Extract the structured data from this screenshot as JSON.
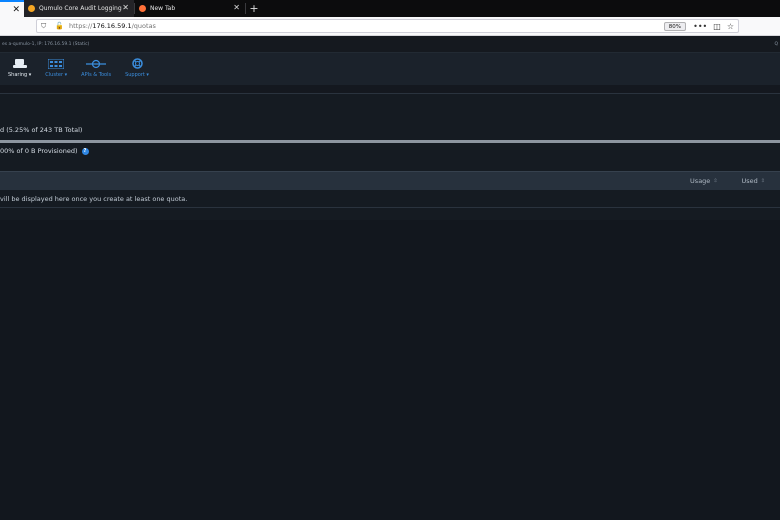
{
  "browser": {
    "tabs": [
      {
        "label": "",
        "active": true
      },
      {
        "label": "Qumulo Core Audit Logging -",
        "favicon_color": "#f5a623"
      },
      {
        "label": "New Tab",
        "favicon_color": "#ff7139"
      }
    ],
    "url_scheme": "https://",
    "url_host": "176.16.59.1",
    "url_path": "/quotas",
    "zoom": "80%"
  },
  "app": {
    "status_text": "es  a-qumulo-1, IP: 176.16.59.1 (Static)",
    "status_right": "Q",
    "nav": [
      {
        "label": "Sharing ▾"
      },
      {
        "label": "Cluster ▾"
      },
      {
        "label": "APIs & Tools"
      },
      {
        "label": "Support ▾"
      }
    ]
  },
  "page": {
    "used_summary": "d (5.25% of 243 TB Total)",
    "provisioned_summary": "00% of 0 B Provisioned)",
    "table": {
      "columns": [
        "Usage",
        "Used"
      ],
      "empty_message": "vill be displayed here once you create at least one quota."
    }
  },
  "colors": {
    "accent": "#3b8ede",
    "header_bg": "#1b222b",
    "page_bg": "#151b22"
  }
}
